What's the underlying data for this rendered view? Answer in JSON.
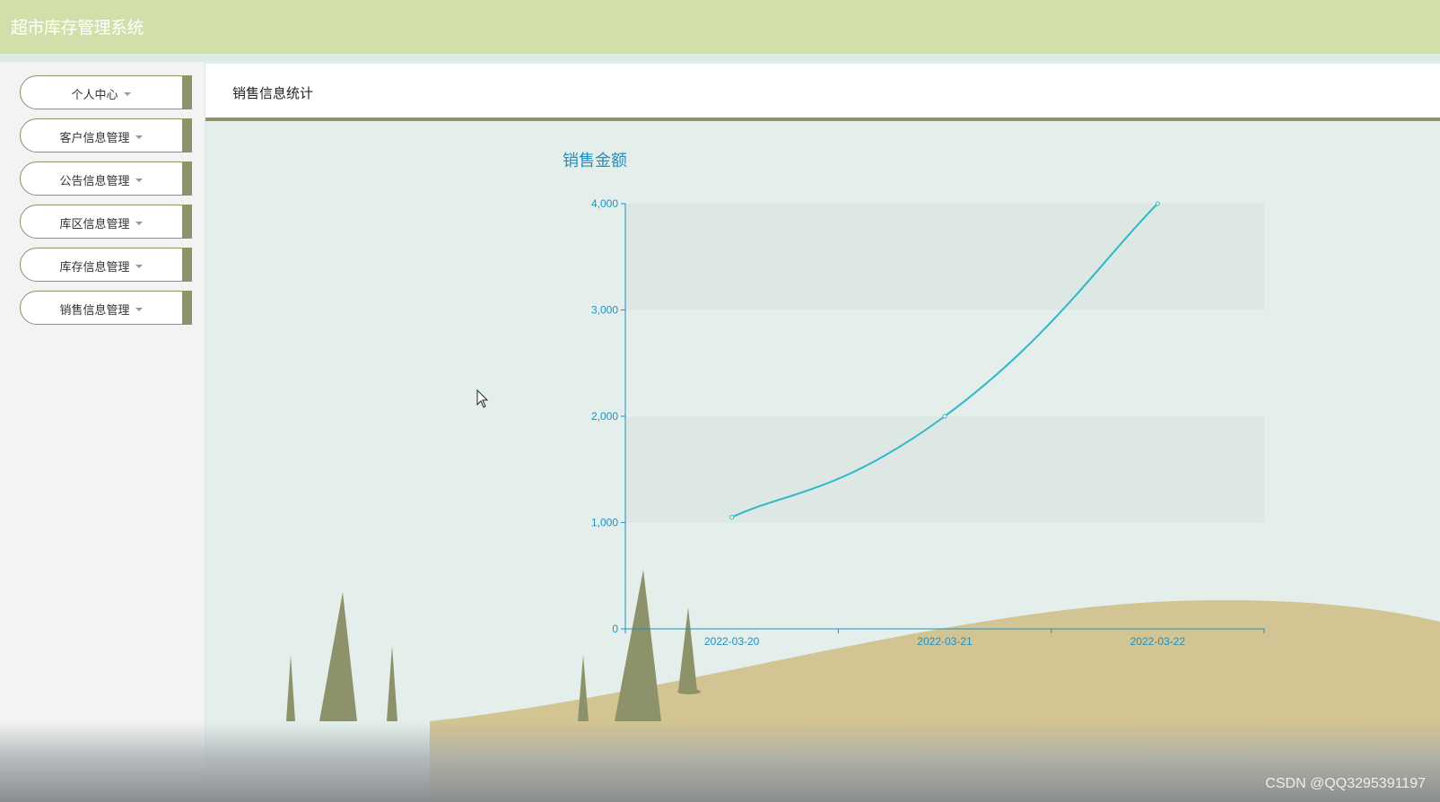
{
  "app": {
    "title": "超市库存管理系统"
  },
  "sidebar": {
    "items": [
      {
        "label": "个人中心",
        "icon": "chevron-down-icon"
      },
      {
        "label": "客户信息管理",
        "icon": "chevron-down-icon"
      },
      {
        "label": "公告信息管理",
        "icon": "chevron-down-icon"
      },
      {
        "label": "库区信息管理",
        "icon": "chevron-down-icon"
      },
      {
        "label": "库存信息管理",
        "icon": "chevron-down-icon"
      },
      {
        "label": "销售信息管理",
        "icon": "chevron-down-icon"
      }
    ]
  },
  "main": {
    "page_title": "销售信息统计"
  },
  "colors": {
    "header": "#d3dfa9",
    "accent": "#8d926a",
    "chart_line": "#2fb8c8",
    "chart_text": "#1f8fc4",
    "hill": "#d2c593",
    "tree": "#8d926a"
  },
  "chart_data": {
    "type": "line",
    "title": "销售金额",
    "categories": [
      "2022-03-20",
      "2022-03-21",
      "2022-03-22"
    ],
    "values": [
      1050,
      2000,
      4000
    ],
    "ylim": [
      0,
      4000
    ],
    "yticks": [
      0,
      1000,
      2000,
      3000,
      4000
    ],
    "ytick_labels": [
      "0",
      "1,000",
      "2,000",
      "3,000",
      "4,000"
    ],
    "smooth": true,
    "split_area": true
  },
  "watermark": "CSDN @QQ3295391197"
}
